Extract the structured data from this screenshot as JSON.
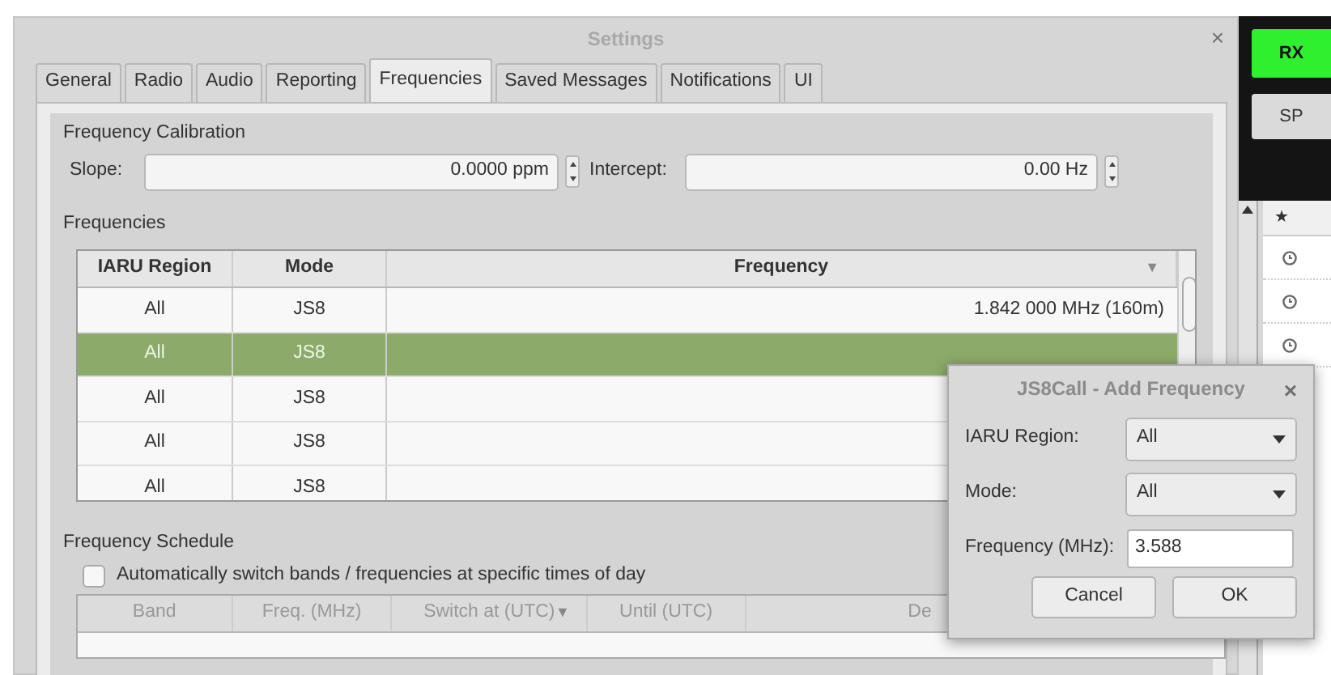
{
  "settings_window": {
    "title": "Settings",
    "close": "×",
    "tabs": [
      {
        "label": "General",
        "selected": false
      },
      {
        "label": "Radio",
        "selected": false
      },
      {
        "label": "Audio",
        "selected": false
      },
      {
        "label": "Reporting",
        "selected": false
      },
      {
        "label": "Frequencies",
        "selected": true
      },
      {
        "label": "Saved Messages",
        "selected": false
      },
      {
        "label": "Notifications",
        "selected": false
      },
      {
        "label": "UI",
        "selected": false
      }
    ],
    "calibration": {
      "title": "Frequency Calibration",
      "slope_label": "Slope:",
      "slope_value": "0.0000 ppm",
      "intercept_label": "Intercept:",
      "intercept_value": "0.00 Hz"
    },
    "frequencies": {
      "title": "Frequencies",
      "columns": [
        {
          "label": "IARU Region"
        },
        {
          "label": "Mode"
        },
        {
          "label": "Frequency",
          "sort": "▼"
        }
      ],
      "rows": [
        {
          "cells": [
            "All",
            "JS8",
            "1.842 000 MHz (160m)"
          ],
          "selected": false
        },
        {
          "cells": [
            "All",
            "JS8"
          ],
          "selected": true
        },
        {
          "cells": [
            "All",
            "JS8"
          ],
          "selected": false
        },
        {
          "cells": [
            "All",
            "JS8"
          ],
          "selected": false
        },
        {
          "cells": [
            "All",
            "JS8"
          ],
          "selected": false
        }
      ]
    },
    "schedule": {
      "title": "Frequency Schedule",
      "auto_switch": {
        "label": "Automatically switch bands / frequencies at specific times of day",
        "checked": false
      },
      "columns": [
        {
          "label": "Band"
        },
        {
          "label": "Freq. (MHz)"
        },
        {
          "label": "Switch at (UTC)",
          "sort": "▼"
        },
        {
          "label": "Until (UTC)"
        },
        {
          "label": "De"
        }
      ]
    }
  },
  "add_dialog": {
    "title": "JS8Call - Add Frequency",
    "close": "×",
    "fields": [
      {
        "kind": "combo",
        "label": "IARU Region:",
        "value": "All"
      },
      {
        "kind": "combo",
        "label": "Mode:",
        "value": "All"
      },
      {
        "kind": "text",
        "label": "Frequency (MHz):",
        "value": "3.588"
      }
    ],
    "buttons": [
      "Cancel",
      "OK"
    ]
  },
  "main_window": {
    "rx_button": "RX",
    "spot_button": "SP",
    "list_header": "★"
  }
}
